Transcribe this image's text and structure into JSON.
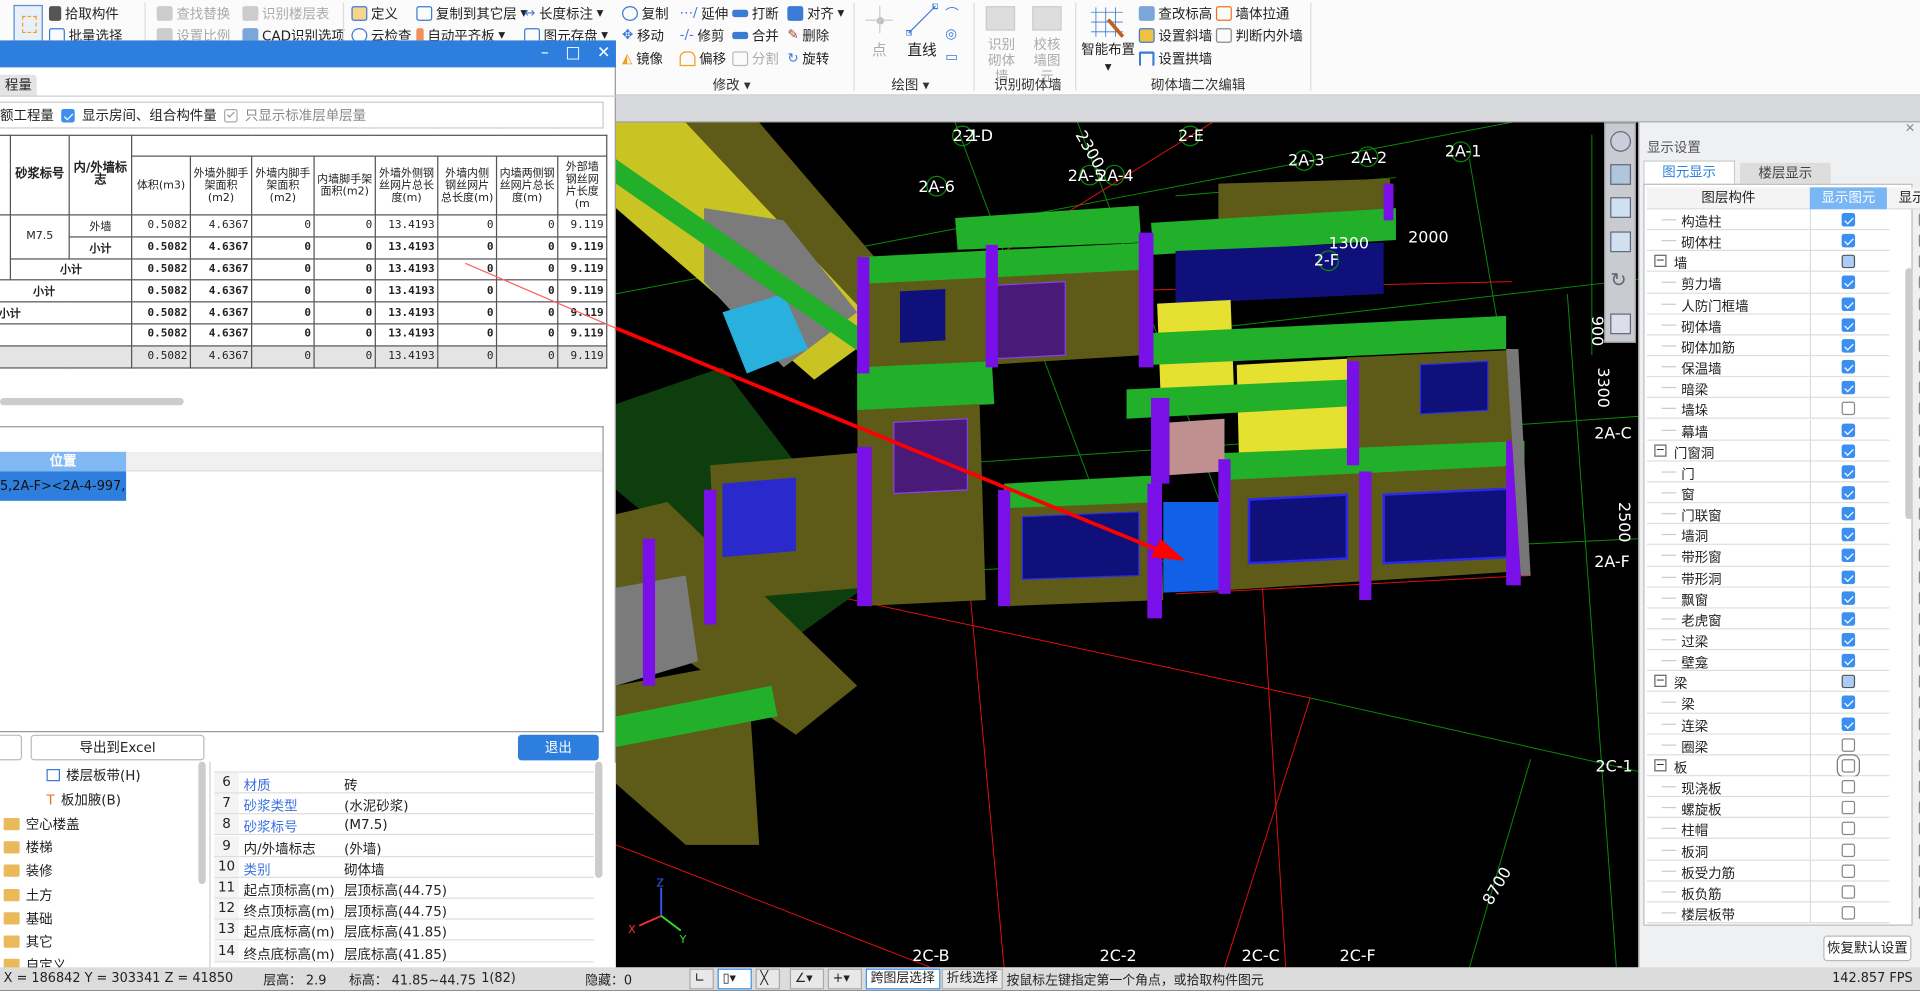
{
  "ribbon": {
    "select": {
      "pick": "拾取构件",
      "batch": "批量选择"
    },
    "cad": {
      "find_replace": "查找替换",
      "set_scale": "设置比例",
      "identify_floor_table": "识别楼层表",
      "cad_options": "CAD识别选项"
    },
    "general": {
      "define": "定义",
      "cloud_check": "云检查",
      "copy_to_floor": "复制到其它层",
      "auto_align_slab": "自动平齐板",
      "length_dim": "长度标注",
      "save_elements": "图元存盘"
    },
    "modify": {
      "copy": "复制",
      "move": "移动",
      "mirror": "镜像",
      "extend": "延伸",
      "trim": "修剪",
      "offset": "偏移",
      "break": "打断",
      "merge": "合并",
      "split": "分割",
      "align": "对齐",
      "delete": "删除",
      "rotate": "旋转",
      "group": "修改"
    },
    "draw": {
      "point": "点",
      "line": "直线",
      "group": "绘图"
    },
    "identify": {
      "identify_wall": "识别砌体墙",
      "check_wall": "校核墙图元",
      "group": "识别砌体墙"
    },
    "secondary": {
      "smart_layout": "智能布置",
      "edit_elevation": "查改标高",
      "set_slope_wall": "设置斜墙",
      "set_arch_wall": "设置拱墙",
      "wall_connect": "墙体拉通",
      "judge_inner_outer": "判断内外墙",
      "group": "砌体墙二次编辑"
    }
  },
  "dialog": {
    "tab": "程量",
    "options": {
      "quota": "额工程量",
      "show_room": "显示房间、组合构件量",
      "show_room_checked": true,
      "std_floor_only": "只显示标准层单层量",
      "std_floor_only_checked": true
    },
    "table": {
      "headers": [
        "砂浆标号",
        "内/外墙标志",
        "体积(m3)",
        "外墙外脚手架面积(m2)",
        "外墙内脚手架面积(m2)",
        "内墙脚手架面积(m2)",
        "外墙外侧钢丝网片总长度(m)",
        "外墙内侧钢丝网片总长度(m)",
        "内墙两侧钢丝网片总长度(m)",
        "外部墙钢丝网片长度(m"
      ],
      "mortar": "M7.5",
      "wall_type": "外墙",
      "subtotal": "小计",
      "values": [
        "0.5082",
        "4.6367",
        "0",
        "0",
        "13.4193",
        "0",
        "0",
        "9.119"
      ]
    },
    "position_header": "位置",
    "position_value": "5,2A-F><2A-4-997,...",
    "export_excel": "导出到Excel",
    "exit": "退出"
  },
  "tree": {
    "items": [
      "楼层板带(H)",
      "板加腋(B)"
    ],
    "folders": [
      "空心楼盖",
      "楼梯",
      "装修",
      "土方",
      "基础",
      "其它",
      "自定义"
    ]
  },
  "properties": [
    {
      "no": "6",
      "name": "材质",
      "value": "砖",
      "blue": true
    },
    {
      "no": "7",
      "name": "砂浆类型",
      "value": "(水泥砂浆)",
      "blue": true
    },
    {
      "no": "8",
      "name": "砂浆标号",
      "value": "(M7.5)",
      "blue": true
    },
    {
      "no": "9",
      "name": "内/外墙标志",
      "value": "(外墙)",
      "blue": false
    },
    {
      "no": "10",
      "name": "类别",
      "value": "砌体墙",
      "blue": true
    },
    {
      "no": "11",
      "name": "起点顶标高(m)",
      "value": "层顶标高(44.75)",
      "blue": false
    },
    {
      "no": "12",
      "name": "终点顶标高(m)",
      "value": "层顶标高(44.75)",
      "blue": false
    },
    {
      "no": "13",
      "name": "起点底标高(m)",
      "value": "层底标高(41.85)",
      "blue": false
    },
    {
      "no": "14",
      "name": "终点底标高(m)",
      "value": "层底标高(41.85)",
      "blue": false
    }
  ],
  "viewport": {
    "axis_labels": [
      "2-1",
      "2-D",
      "2300",
      "2-E",
      "2A-3",
      "2A-2",
      "2A-1",
      "2A-6",
      "2A-5",
      "2A-4",
      "1300",
      "2000",
      "2-F",
      "900",
      "3300",
      "2A-C",
      "2500",
      "2A-F",
      "2C-1",
      "8700",
      "2C-B",
      "2C-2",
      "2C-C",
      "2C-F"
    ]
  },
  "display_panel": {
    "title": "显示设置",
    "tabs": [
      "图元显示",
      "楼层显示"
    ],
    "columns": [
      "图层构件",
      "显示图元",
      "显示名称"
    ],
    "rows": [
      {
        "label": "构造柱",
        "show": "on",
        "name": false,
        "level": 1
      },
      {
        "label": "砌体柱",
        "show": "on",
        "name": false,
        "level": 1
      },
      {
        "label": "墙",
        "show": "part",
        "name": false,
        "level": 0
      },
      {
        "label": "剪力墙",
        "show": "on",
        "name": false,
        "level": 1
      },
      {
        "label": "人防门框墙",
        "show": "on",
        "name": false,
        "level": 1
      },
      {
        "label": "砌体墙",
        "show": "on",
        "name": false,
        "level": 1
      },
      {
        "label": "砌体加筋",
        "show": "on",
        "name": false,
        "level": 1
      },
      {
        "label": "保温墙",
        "show": "on",
        "name": false,
        "level": 1
      },
      {
        "label": "暗梁",
        "show": "on",
        "name": false,
        "level": 1
      },
      {
        "label": "墙垛",
        "show": "off",
        "name": false,
        "level": 1
      },
      {
        "label": "幕墙",
        "show": "on",
        "name": false,
        "level": 1
      },
      {
        "label": "门窗洞",
        "show": "on",
        "name": false,
        "level": 0
      },
      {
        "label": "门",
        "show": "on",
        "name": false,
        "level": 1
      },
      {
        "label": "窗",
        "show": "on",
        "name": false,
        "level": 1
      },
      {
        "label": "门联窗",
        "show": "on",
        "name": false,
        "level": 1
      },
      {
        "label": "墙洞",
        "show": "on",
        "name": false,
        "level": 1
      },
      {
        "label": "带形窗",
        "show": "on",
        "name": false,
        "level": 1
      },
      {
        "label": "带形洞",
        "show": "on",
        "name": false,
        "level": 1
      },
      {
        "label": "飘窗",
        "show": "on",
        "name": false,
        "level": 1
      },
      {
        "label": "老虎窗",
        "show": "on",
        "name": false,
        "level": 1
      },
      {
        "label": "过梁",
        "show": "on",
        "name": false,
        "level": 1
      },
      {
        "label": "壁龛",
        "show": "on",
        "name": false,
        "level": 1
      },
      {
        "label": "梁",
        "show": "part",
        "name": false,
        "level": 0
      },
      {
        "label": "梁",
        "show": "on",
        "name": false,
        "level": 1
      },
      {
        "label": "连梁",
        "show": "on",
        "name": false,
        "level": 1
      },
      {
        "label": "圈梁",
        "show": "off",
        "name": false,
        "level": 1
      },
      {
        "label": "板",
        "show": "off",
        "name": false,
        "level": 0
      },
      {
        "label": "现浇板",
        "show": "off",
        "name": false,
        "level": 1
      },
      {
        "label": "螺旋板",
        "show": "off",
        "name": false,
        "level": 1
      },
      {
        "label": "柱帽",
        "show": "off",
        "name": false,
        "level": 1
      },
      {
        "label": "板洞",
        "show": "off",
        "name": false,
        "level": 1
      },
      {
        "label": "板受力筋",
        "show": "off",
        "name": false,
        "level": 1
      },
      {
        "label": "板负筋",
        "show": "off",
        "name": false,
        "level": 1
      },
      {
        "label": "楼层板带",
        "show": "off",
        "name": false,
        "level": 1
      }
    ],
    "restore": "恢复默认设置"
  },
  "status": {
    "coords": "X = 186842 Y = 303341 Z = 41850",
    "floor_height": "层高： 2.9",
    "elevation": "标高： 41.85~44.75",
    "count": "1(82)",
    "hidden": "隐藏：0",
    "cross_layer": "跨图层选择",
    "polyline_select": "折线选择",
    "hint": "按鼠标左键指定第一个角点，或拾取构件图元",
    "fps": "142.857 FPS"
  },
  "colors": {
    "accent": "#2e7fdd",
    "wall_olive": "#5e5a18",
    "beam_green": "#22b02a",
    "column_purple": "#7a10e8",
    "window_navy": "#10107a"
  }
}
